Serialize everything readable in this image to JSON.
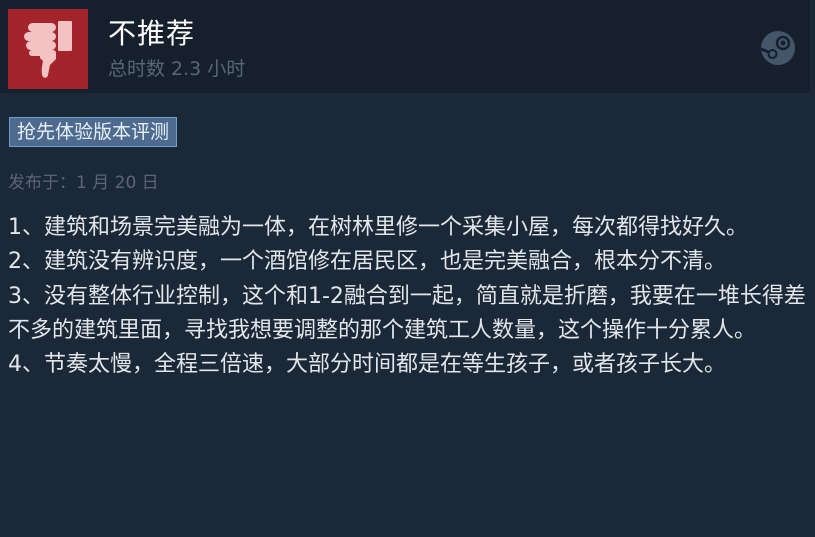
{
  "review": {
    "verdict": "不推荐",
    "hours_played": "总时数 2.3 小时",
    "badge": "抢先体验版本评测",
    "posted": "发布于：1 月 20 日",
    "paragraphs": [
      "1、建筑和场景完美融为一体，在树林里修一个采集小屋，每次都得找好久。",
      "2、建筑没有辨识度，一个酒馆修在居民区，也是完美融合，根本分不清。",
      "3、没有整体行业控制，这个和1-2融合到一起，简直就是折磨，我要在一堆长得差不多的建筑里面，寻找我想要调整的那个建筑工人数量，这个操作十分累人。",
      "4、节奏太慢，全程三倍速，大部分时间都是在等生孩子，或者孩子长大。"
    ]
  },
  "icons": {
    "verdict_icon": "thumbs-down-icon",
    "platform_icon": "steam-logo-icon"
  },
  "colors": {
    "background": "#1b2838",
    "header_background": "#16202d",
    "thumb_background": "#a3242a",
    "badge_background": "#4e6a8e",
    "badge_border": "#6aa1d3",
    "muted_text": "#5a6675",
    "body_text": "#e2e6ea"
  }
}
